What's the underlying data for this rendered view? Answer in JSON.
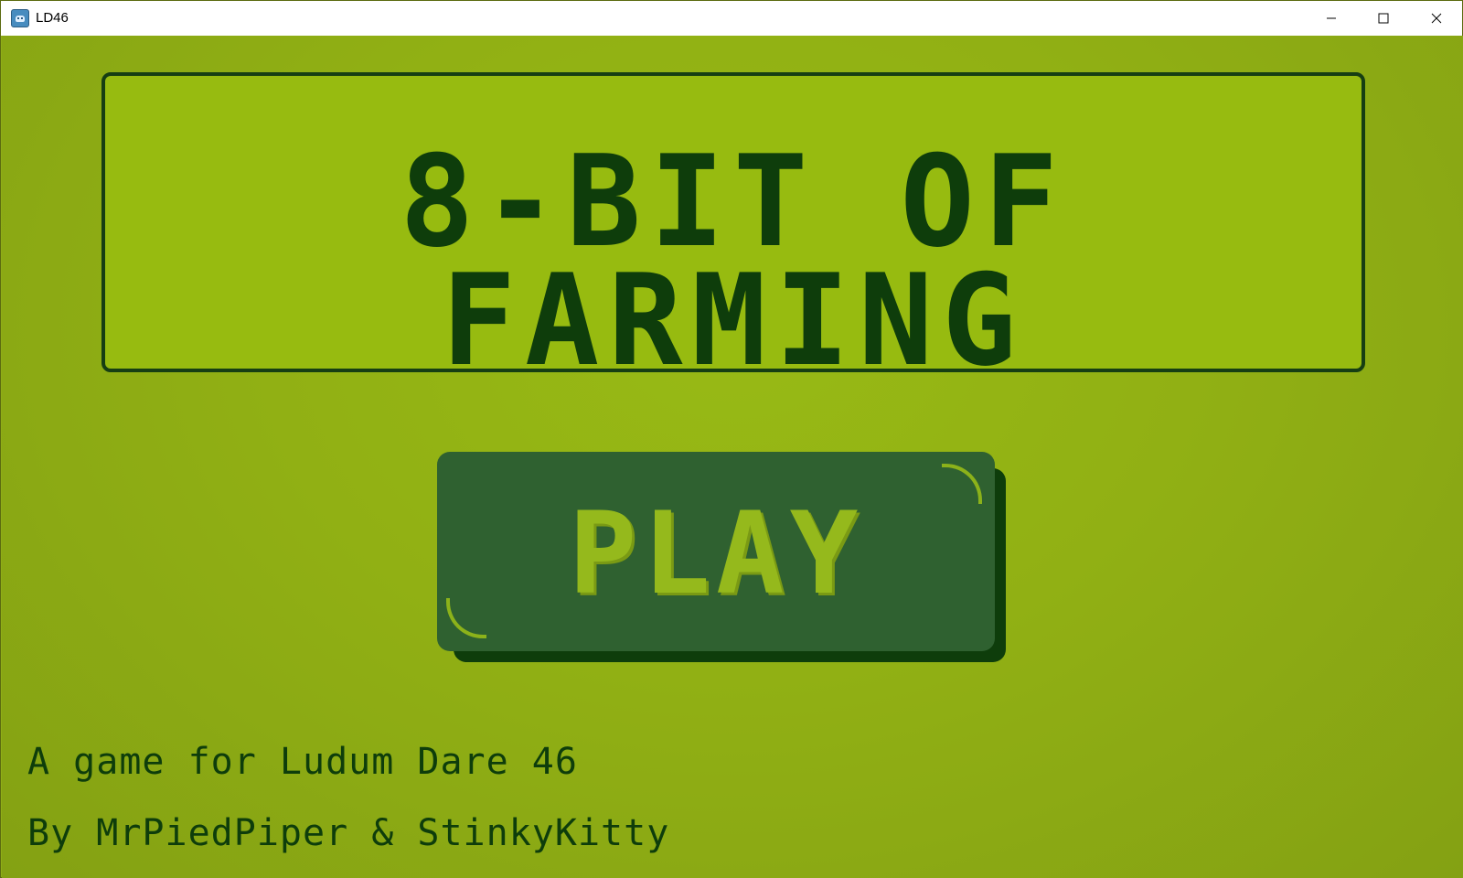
{
  "window": {
    "title": "LD46"
  },
  "game": {
    "title": "8-BIT OF FARMING",
    "play_button_label": "PLAY",
    "credit_line_1": "A game for Ludum Dare 46",
    "credit_line_2": "By MrPiedPiper & StinkyKitty"
  },
  "colors": {
    "background": "#8fad16",
    "panel": "#97bb10",
    "dark_green": "#0e3d0b",
    "button_face": "#2f6130",
    "button_text": "#95b91c"
  },
  "icons": {
    "app": "godot-icon",
    "minimize": "minimize-icon",
    "maximize": "maximize-icon",
    "close": "close-icon"
  }
}
